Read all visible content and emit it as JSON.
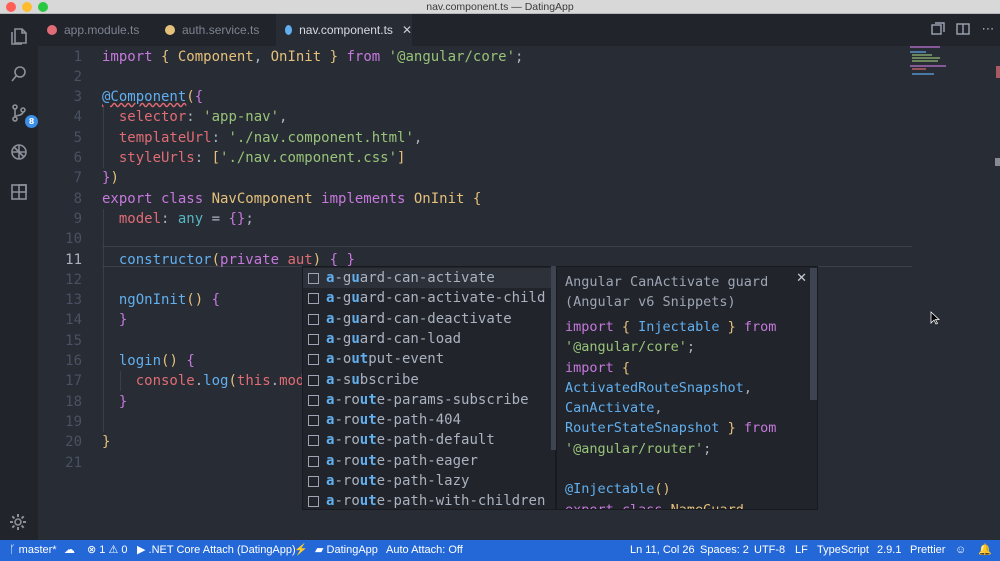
{
  "window": {
    "title": "nav.component.ts — DatingApp"
  },
  "colors": {
    "statusbar": "#2468d8",
    "editor_bg": "#282c34",
    "tab_bg": "#21252b",
    "accent": "#61afef"
  },
  "activity": {
    "items": [
      "files-icon",
      "search-icon",
      "source-control-icon",
      "debug-icon",
      "extensions-icon"
    ],
    "scm_badge": "8"
  },
  "tabs": [
    {
      "label": "app.module.ts",
      "icon": "angular-icon",
      "color": "#e06c75"
    },
    {
      "label": "auth.service.ts",
      "icon": "angular-icon",
      "color": "#e5c07b"
    },
    {
      "label": "nav.component.ts",
      "icon": "angular-icon",
      "color": "#61afef",
      "close": "✕"
    }
  ],
  "editor": {
    "line_numbers": [
      "1",
      "2",
      "3",
      "4",
      "5",
      "6",
      "7",
      "8",
      "9",
      "10",
      "11",
      "12",
      "13",
      "14",
      "15",
      "16",
      "17",
      "18",
      "19",
      "20",
      "21"
    ],
    "current_line": "11",
    "lines": [
      [
        [
          "k",
          "import "
        ],
        [
          "y",
          "{ "
        ],
        [
          "c",
          "Component"
        ],
        [
          "w",
          ", "
        ],
        [
          "c",
          "OnInit"
        ],
        [
          "y",
          " }"
        ],
        [
          "k",
          " from "
        ],
        [
          "s",
          "'@angular/core'"
        ],
        [
          "w",
          ";"
        ]
      ],
      [],
      [
        [
          "deco",
          "@Component"
        ],
        [
          "y",
          "("
        ],
        [
          "k",
          "{"
        ]
      ],
      [
        [
          "w",
          "  "
        ],
        [
          "p",
          "selector"
        ],
        [
          "w",
          ": "
        ],
        [
          "s",
          "'app-nav'"
        ],
        [
          "w",
          ","
        ]
      ],
      [
        [
          "w",
          "  "
        ],
        [
          "p",
          "templateUrl"
        ],
        [
          "w",
          ": "
        ],
        [
          "s",
          "'./nav.component.html'"
        ],
        [
          "w",
          ","
        ]
      ],
      [
        [
          "w",
          "  "
        ],
        [
          "p",
          "styleUrls"
        ],
        [
          "w",
          ": "
        ],
        [
          "y",
          "["
        ],
        [
          "s",
          "'./nav.component.css'"
        ],
        [
          "y",
          "]"
        ]
      ],
      [
        [
          "k",
          "}"
        ],
        [
          "y",
          ")"
        ]
      ],
      [
        [
          "k",
          "export class "
        ],
        [
          "c",
          "NavComponent "
        ],
        [
          "k",
          "implements "
        ],
        [
          "c",
          "OnInit "
        ],
        [
          "y",
          "{"
        ]
      ],
      [
        [
          "w",
          "  "
        ],
        [
          "p",
          "model"
        ],
        [
          "w",
          ": "
        ],
        [
          "t",
          "any "
        ],
        [
          "w",
          "= "
        ],
        [
          "k",
          "{}"
        ],
        [
          "w",
          ";"
        ]
      ],
      [],
      [
        [
          "w",
          "  "
        ],
        [
          "f",
          "constructor"
        ],
        [
          "y",
          "("
        ],
        [
          "k",
          "private "
        ],
        [
          "p",
          "aut"
        ],
        [
          "y",
          ")"
        ],
        [
          "w",
          " "
        ],
        [
          "k",
          "{ }"
        ]
      ],
      [],
      [
        [
          "w",
          "  "
        ],
        [
          "f",
          "ngOnInit"
        ],
        [
          "y",
          "() "
        ],
        [
          "k",
          "{"
        ]
      ],
      [
        [
          "w",
          "  "
        ],
        [
          "k",
          "}"
        ]
      ],
      [],
      [
        [
          "w",
          "  "
        ],
        [
          "f",
          "login"
        ],
        [
          "y",
          "() "
        ],
        [
          "k",
          "{"
        ]
      ],
      [
        [
          "w",
          "    "
        ],
        [
          "p",
          "console"
        ],
        [
          "w",
          "."
        ],
        [
          "f",
          "log"
        ],
        [
          "y",
          "("
        ],
        [
          "p",
          "this"
        ],
        [
          "w",
          "."
        ],
        [
          "p",
          "mode"
        ]
      ],
      [
        [
          "w",
          "  "
        ],
        [
          "k",
          "}"
        ]
      ],
      [],
      [
        [
          "y",
          "}"
        ]
      ],
      []
    ]
  },
  "suggestions": [
    "a-guard-can-activate",
    "a-guard-can-activate-child",
    "a-guard-can-deactivate",
    "a-guard-can-load",
    "a-output-event",
    "a-subscribe",
    "a-route-params-subscribe",
    "a-route-path-404",
    "a-route-path-default",
    "a-route-path-eager",
    "a-route-path-lazy",
    "a-route-path-with-children"
  ],
  "details": {
    "title": "Angular CanActivate guard (Angular v6 Snippets)",
    "close": "✕",
    "code": [
      [
        [
          "k",
          "import "
        ],
        [
          "y",
          "{ "
        ],
        [
          "f",
          "Injectable"
        ],
        [
          "y",
          " } "
        ],
        [
          "k",
          "from"
        ]
      ],
      [
        [
          "s",
          "'@angular/core'"
        ],
        [
          "w",
          ";"
        ]
      ],
      [
        [
          "k",
          "import "
        ],
        [
          "y",
          "{"
        ]
      ],
      [
        [
          "f",
          "ActivatedRouteSnapshot"
        ],
        [
          "w",
          ","
        ]
      ],
      [
        [
          "f",
          "CanActivate"
        ],
        [
          "w",
          ","
        ]
      ],
      [
        [
          "f",
          "RouterStateSnapshot"
        ],
        [
          "y",
          " } "
        ],
        [
          "k",
          "from"
        ]
      ],
      [
        [
          "s",
          "'@angular/router'"
        ],
        [
          "w",
          ";"
        ]
      ],
      [],
      [
        [
          "f",
          "@Injectable"
        ],
        [
          "y",
          "()"
        ]
      ],
      [
        [
          "k",
          "export class "
        ],
        [
          "c",
          "NameGuard"
        ]
      ]
    ]
  },
  "statusbar": {
    "branch": "master*",
    "sync_icon": "cloud-sync-icon",
    "errors": "1",
    "warnings": "0",
    "debug": ".NET Core Attach (DatingApp)",
    "folder": "DatingApp",
    "auto_attach": "Auto Attach: Off",
    "position": "Ln 11, Col 26",
    "spaces": "Spaces: 2",
    "encoding": "UTF-8",
    "eol": "LF",
    "language": "TypeScript",
    "version": "2.9.1",
    "formatter": "Prettier"
  }
}
